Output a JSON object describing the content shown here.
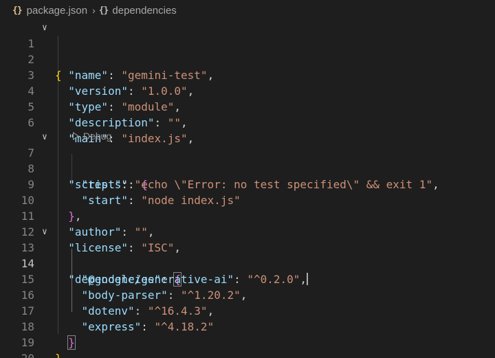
{
  "breadcrumb": {
    "file": "package.json",
    "section": "dependencies"
  },
  "codelens": {
    "debug_label": "Debug"
  },
  "lines": {
    "l1": {
      "num": "1",
      "open": "{"
    },
    "l2": {
      "num": "2",
      "key": "\"name\"",
      "colon": ": ",
      "value": "\"gemini-test\"",
      "comma": ","
    },
    "l3": {
      "num": "3",
      "key": "\"version\"",
      "colon": ": ",
      "value": "\"1.0.0\"",
      "comma": ","
    },
    "l4": {
      "num": "4",
      "key": "\"type\"",
      "colon": ": ",
      "value": "\"module\"",
      "comma": ","
    },
    "l5": {
      "num": "5",
      "key": "\"description\"",
      "colon": ": ",
      "value": "\"\"",
      "comma": ","
    },
    "l6": {
      "num": "6",
      "key": "\"main\"",
      "colon": ": ",
      "value": "\"index.js\"",
      "comma": ","
    },
    "l7": {
      "num": "7",
      "key": "\"scripts\"",
      "colon": ": ",
      "open": "{"
    },
    "l8": {
      "num": "8",
      "key": "\"test\"",
      "colon": ": ",
      "value": "\"echo \\\"Error: no test specified\\\" && exit 1\"",
      "comma": ","
    },
    "l9": {
      "num": "9",
      "key": "\"start\"",
      "colon": ": ",
      "value": "\"node index.js\""
    },
    "l10": {
      "num": "10",
      "close": "}",
      "comma": ","
    },
    "l11": {
      "num": "11",
      "key": "\"author\"",
      "colon": ": ",
      "value": "\"\"",
      "comma": ","
    },
    "l12": {
      "num": "12",
      "key": "\"license\"",
      "colon": ": ",
      "value": "\"ISC\"",
      "comma": ","
    },
    "l13": {
      "num": "13",
      "key": "\"dependencies\"",
      "colon": ": ",
      "open": "{"
    },
    "l14": {
      "num": "14",
      "key": "\"@google/generative-ai\"",
      "colon": ": ",
      "value": "\"^0.2.0\"",
      "comma": ","
    },
    "l15": {
      "num": "15",
      "key": "\"body-parser\"",
      "colon": ": ",
      "value": "\"^1.20.2\"",
      "comma": ","
    },
    "l16": {
      "num": "16",
      "key": "\"dotenv\"",
      "colon": ": ",
      "value": "\"^16.4.3\"",
      "comma": ","
    },
    "l17": {
      "num": "17",
      "key": "\"express\"",
      "colon": ": ",
      "value": "\"^4.18.2\""
    },
    "l18": {
      "num": "18",
      "close": "}"
    },
    "l19": {
      "num": "19",
      "close": "}"
    },
    "l20": {
      "num": "20"
    }
  },
  "colors": {
    "background": "#1e1e1e",
    "key": "#9cdcfe",
    "string": "#ce9178",
    "bracket_level1": "#ffd700",
    "bracket_level2": "#da70d6",
    "line_number": "#858585"
  }
}
